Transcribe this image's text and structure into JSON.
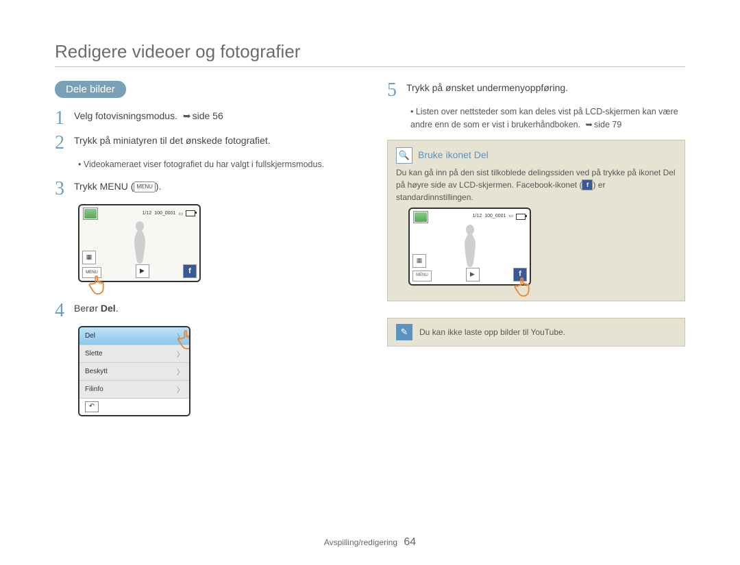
{
  "title": "Redigere videoer og fotografier",
  "section_heading": "Dele bilder",
  "steps": {
    "s1": {
      "num": "1",
      "text_a": "Velg fotovisningsmodus. ",
      "page_ref": "side 56"
    },
    "s2": {
      "num": "2",
      "text": "Trykk på miniatyren til det ønskede fotografiet."
    },
    "s2_bullet": "Videokameraet viser fotografiet du har valgt i fullskjermsmodus.",
    "s3": {
      "num": "3",
      "text_a": "Trykk MENU (",
      "text_b": ")."
    },
    "s4": {
      "num": "4",
      "text_a": "Berør ",
      "bold": "Del",
      "text_b": "."
    },
    "s5": {
      "num": "5",
      "text": "Trykk på ønsket undermenyoppføring."
    },
    "s5_bullet_a": "Listen over nettsteder som kan deles vist på LCD-skjermen kan være andre enn de som er vist i brukerhåndboken. ",
    "s5_page_ref": "side 79"
  },
  "lcd": {
    "counter": "1/12",
    "file": "100_0001",
    "menu_label": "MENU"
  },
  "list_menu": {
    "items": [
      "Del",
      "Slette",
      "Beskytt",
      "Filinfo"
    ]
  },
  "tip": {
    "heading": "Bruke ikonet Del",
    "body_a": "Du kan gå inn på den sist tilkoblede delingssiden ved på trykke på ikonet Del på høyre side av LCD-skjermen. Facebook-ikonet (",
    "body_b": ") er standardinnstillingen."
  },
  "note": "Du kan ikke laste opp bilder til YouTube.",
  "footer": {
    "section": "Avspilling/redigering",
    "page": "64"
  }
}
